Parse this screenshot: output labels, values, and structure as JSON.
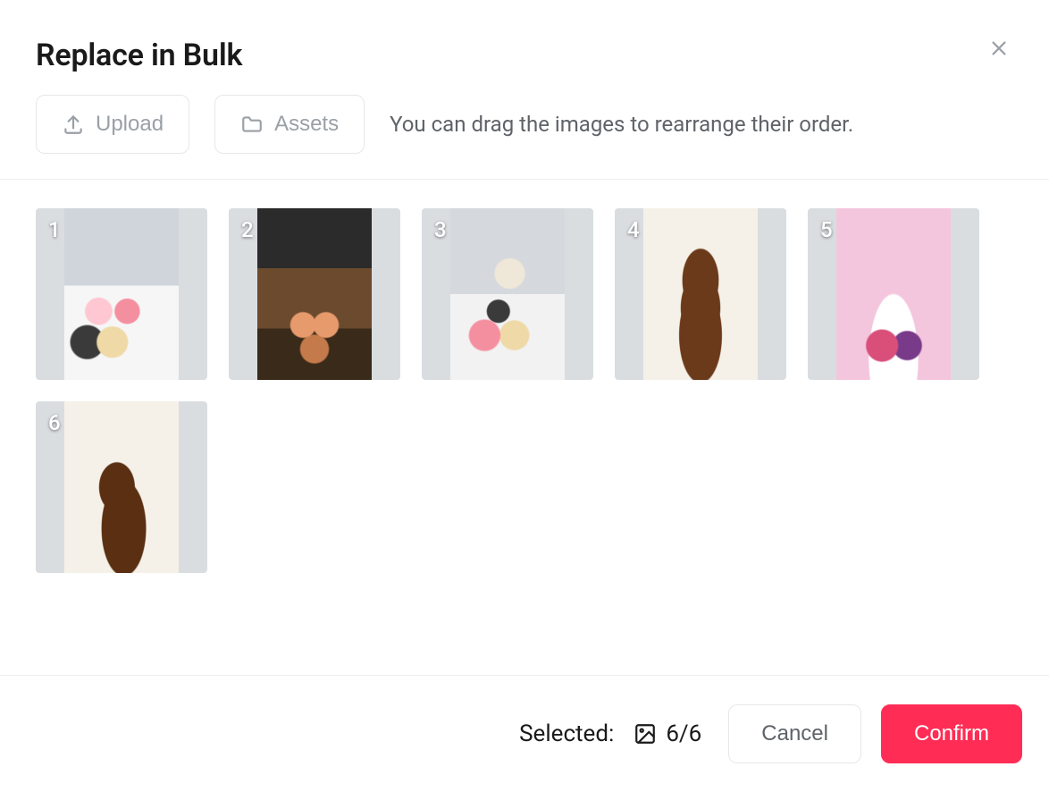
{
  "header": {
    "title": "Replace in Bulk"
  },
  "toolbar": {
    "upload_label": "Upload",
    "assets_label": "Assets",
    "hint": "You can drag the images to rearrange their order."
  },
  "images": [
    {
      "index": "1"
    },
    {
      "index": "2"
    },
    {
      "index": "3"
    },
    {
      "index": "4"
    },
    {
      "index": "5"
    },
    {
      "index": "6"
    }
  ],
  "footer": {
    "selected_label": "Selected:",
    "selected_count": "6/6",
    "cancel_label": "Cancel",
    "confirm_label": "Confirm"
  },
  "colors": {
    "primary": "#ff2d55",
    "border": "#e5e7eb",
    "muted_text": "#9aa0a6"
  }
}
